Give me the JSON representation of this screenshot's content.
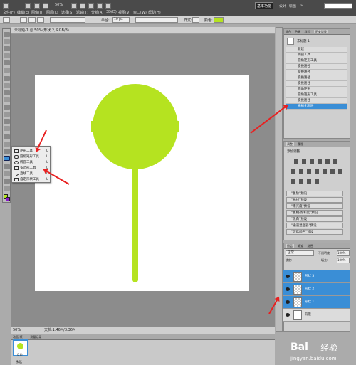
{
  "menubar": {
    "items": [
      "文件(F)",
      "编辑(E)",
      "图像(I)",
      "图层(L)",
      "选择(S)",
      "滤镜(T)",
      "分析(A)",
      "3D(D)",
      "视图(V)",
      "窗口(W)",
      "帮助(H)"
    ],
    "zoom": "50%",
    "workspace_button": "基本功能",
    "workspace_links": [
      "设计",
      "绘画"
    ],
    "more_icon": "»",
    "colors": {
      "bg": "#4a4a4a"
    }
  },
  "options": {
    "radius_label": "半径:",
    "radius_value": "10 px",
    "style_label": "样式:",
    "color_label": "颜色:",
    "color_swatch": "#b5e320"
  },
  "document": {
    "tab_title": "未标题-1 @ 50%(形状 2, RGB/8)",
    "zoom_status": "50%",
    "doc_info": "文档:1.46M/3.36M"
  },
  "flyout": {
    "items": [
      {
        "label": "矩形工具",
        "key": "U"
      },
      {
        "label": "圆角矩形工具",
        "key": "U"
      },
      {
        "label": "椭圆工具",
        "key": "U"
      },
      {
        "label": "多边形工具",
        "key": "U"
      },
      {
        "label": "直线工具",
        "key": "U"
      },
      {
        "label": "自定形状工具",
        "key": "U"
      }
    ]
  },
  "history": {
    "tabs": [
      "颜色",
      "色板",
      "样式",
      "历史记录"
    ],
    "doc_name": "未标题-1",
    "items": [
      "新建",
      "椭圆工具",
      "圆角矩形工具",
      "变换路径",
      "变换路径",
      "变换路径",
      "变换路径",
      "圆角矩形",
      "圆角矩形工具",
      "变换路径",
      "栅格化图层"
    ],
    "selected_index": 10
  },
  "adjustments": {
    "tabs": [
      "调整",
      "蒙版"
    ],
    "heading": "添加调整",
    "presets": [
      "\"色阶\"预设",
      "\"曲线\"预设",
      "\"曝光度\"预设",
      "\"色相/饱和度\"预设",
      "\"黑白\"预设",
      "\"通道混合器\"预设",
      "\"可选颜色\"预设"
    ]
  },
  "layers": {
    "tabs": [
      "图层",
      "通道",
      "路径"
    ],
    "blend_mode": "正常",
    "opacity_label": "不透明度:",
    "opacity_value": "100%",
    "lock_label": "锁定:",
    "fill_label": "填充:",
    "fill_value": "100%",
    "rows": [
      {
        "name": "形状 3",
        "selected": true
      },
      {
        "name": "形状 2",
        "selected": true
      },
      {
        "name": "形状 1",
        "selected": true
      },
      {
        "name": "背景",
        "selected": false
      }
    ]
  },
  "animation": {
    "tabs": [
      "动画(帧)",
      "测量记录"
    ],
    "frame_time": "0 秒",
    "loop": "永远"
  },
  "watermark": {
    "brand": "Bai",
    "brand_cn": "经验",
    "url": "jingyan.baidu.com"
  }
}
